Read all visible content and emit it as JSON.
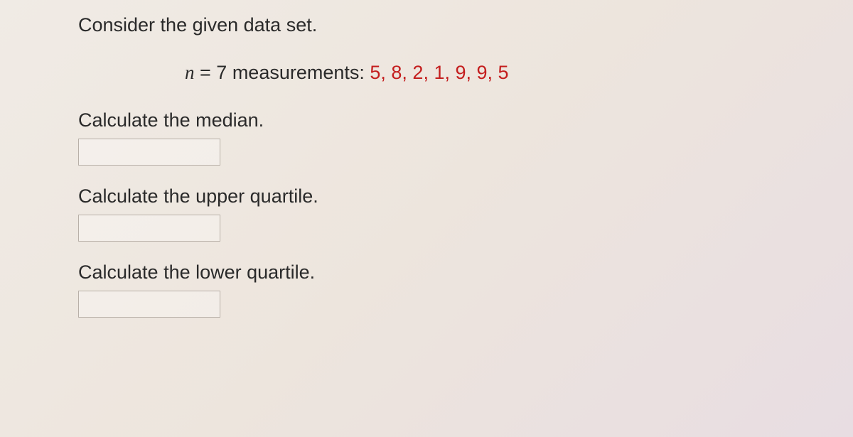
{
  "intro": "Consider the given data set.",
  "equation": {
    "variable": "n",
    "equals": " = ",
    "count": "7",
    "label": " measurements: ",
    "values": "5, 8, 2, 1, 9, 9, 5"
  },
  "questions": [
    {
      "prompt": "Calculate the median.",
      "value": ""
    },
    {
      "prompt": "Calculate the upper quartile.",
      "value": ""
    },
    {
      "prompt": "Calculate the lower quartile.",
      "value": ""
    }
  ]
}
